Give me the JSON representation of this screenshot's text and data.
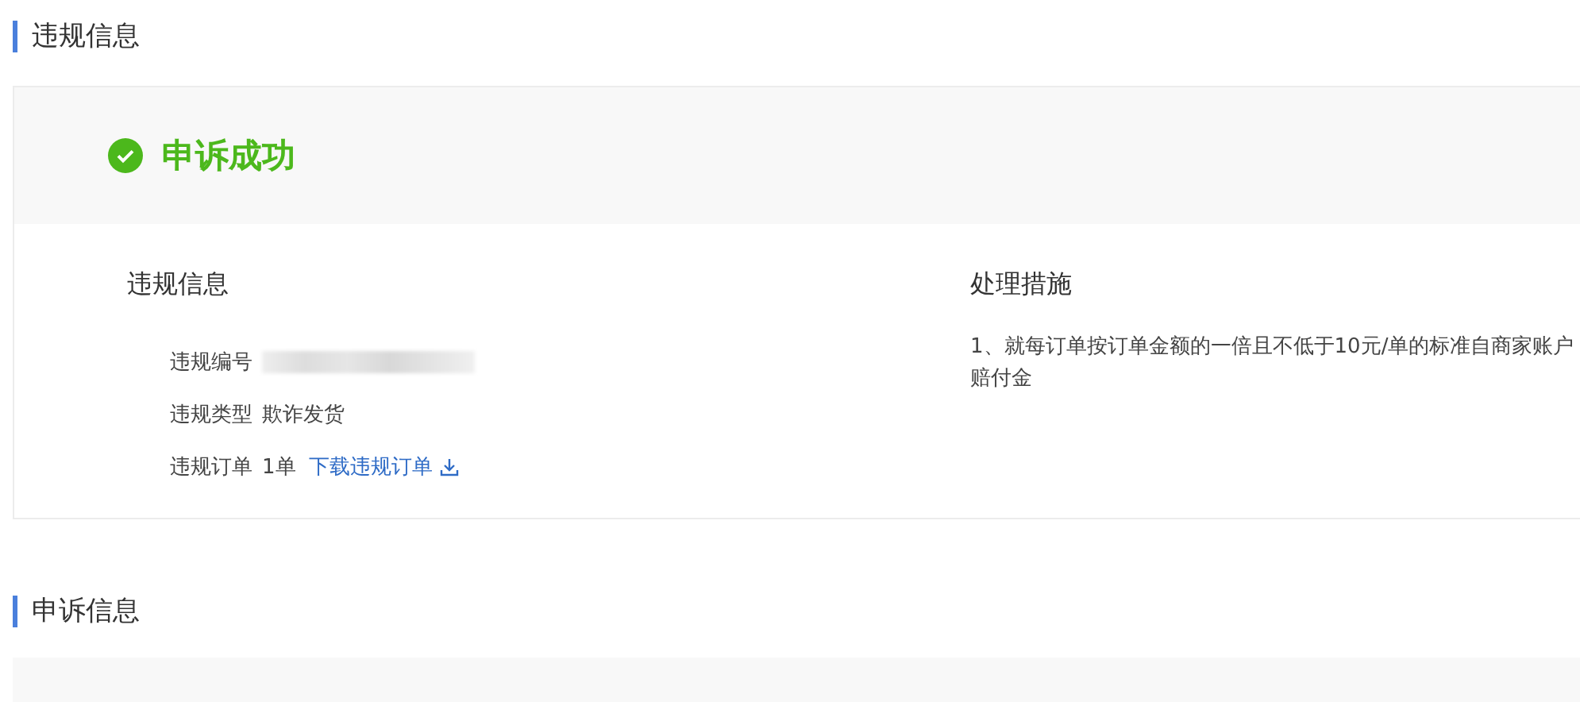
{
  "violation_section": {
    "title": "违规信息"
  },
  "status": {
    "kind": "success",
    "text": "申诉成功"
  },
  "violation_info": {
    "title": "违规信息",
    "fields": [
      {
        "label": "违规编号",
        "kind": "redacted"
      },
      {
        "label": "违规类型",
        "kind": "text",
        "value": "欺诈发货"
      },
      {
        "label": "违规订单",
        "kind": "order",
        "value": "1单",
        "link": "下载违规订单"
      }
    ]
  },
  "measures": {
    "title": "处理措施",
    "lines": [
      "1、就每订单按订单金额的一倍且不低于10元/单的标准自商家账户",
      "赔付金"
    ]
  },
  "appeal_section": {
    "title": "申诉信息"
  }
}
